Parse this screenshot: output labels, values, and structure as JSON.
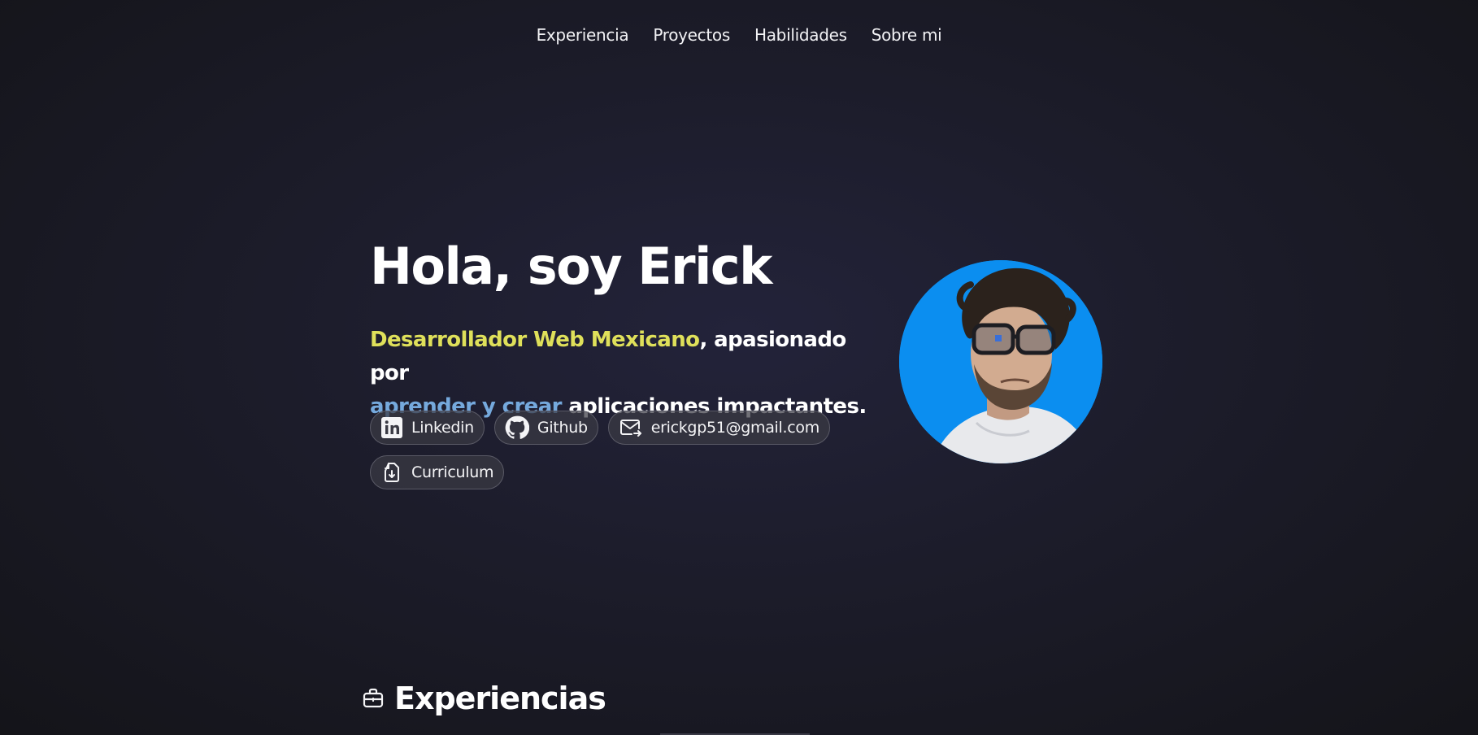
{
  "nav": {
    "items": [
      {
        "label": "Experiencia"
      },
      {
        "label": "Proyectos"
      },
      {
        "label": "Habilidades"
      },
      {
        "label": "Sobre mi"
      }
    ]
  },
  "hero": {
    "title": "Hola, soy Erick",
    "highlight_1": "Desarrollador Web Mexicano",
    "text_1": ", apasionado por",
    "highlight_2": "aprender y crear",
    "text_2": " aplicaciones impactantes."
  },
  "links": [
    {
      "label": "Linkedin",
      "icon": "linkedin-icon"
    },
    {
      "label": "Github",
      "icon": "github-icon"
    },
    {
      "label": "erickgp51@gmail.com",
      "icon": "mail-icon"
    },
    {
      "label": "Curriculum",
      "icon": "document-download-icon"
    }
  ],
  "experience": {
    "title": "Experiencias",
    "icon": "briefcase-icon"
  },
  "colors": {
    "accent_yellow": "#dfe05a",
    "accent_blue": "#75a9dd",
    "avatar_bg": "#0b8ef0",
    "background": "#1c1c2a"
  }
}
